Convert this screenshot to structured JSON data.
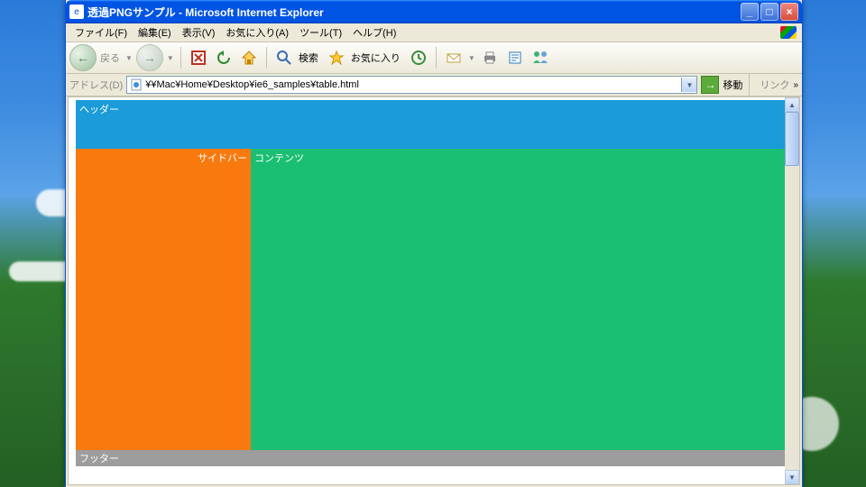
{
  "window": {
    "title": "透過PNGサンプル - Microsoft Internet Explorer"
  },
  "menu": {
    "items": [
      "ファイル(F)",
      "編集(E)",
      "表示(V)",
      "お気に入り(A)",
      "ツール(T)",
      "ヘルプ(H)"
    ]
  },
  "toolbar": {
    "back_label": "戻る",
    "search_label": "検索",
    "favorites_label": "お気に入り"
  },
  "address": {
    "label": "アドレス(D)",
    "value": "¥¥Mac¥Home¥Desktop¥ie6_samples¥table.html",
    "go_label": "移動",
    "links_label": "リンク"
  },
  "page": {
    "header": "ヘッダー",
    "sidebar": "サイドバー",
    "content": "コンテンツ",
    "footer": "フッター"
  }
}
